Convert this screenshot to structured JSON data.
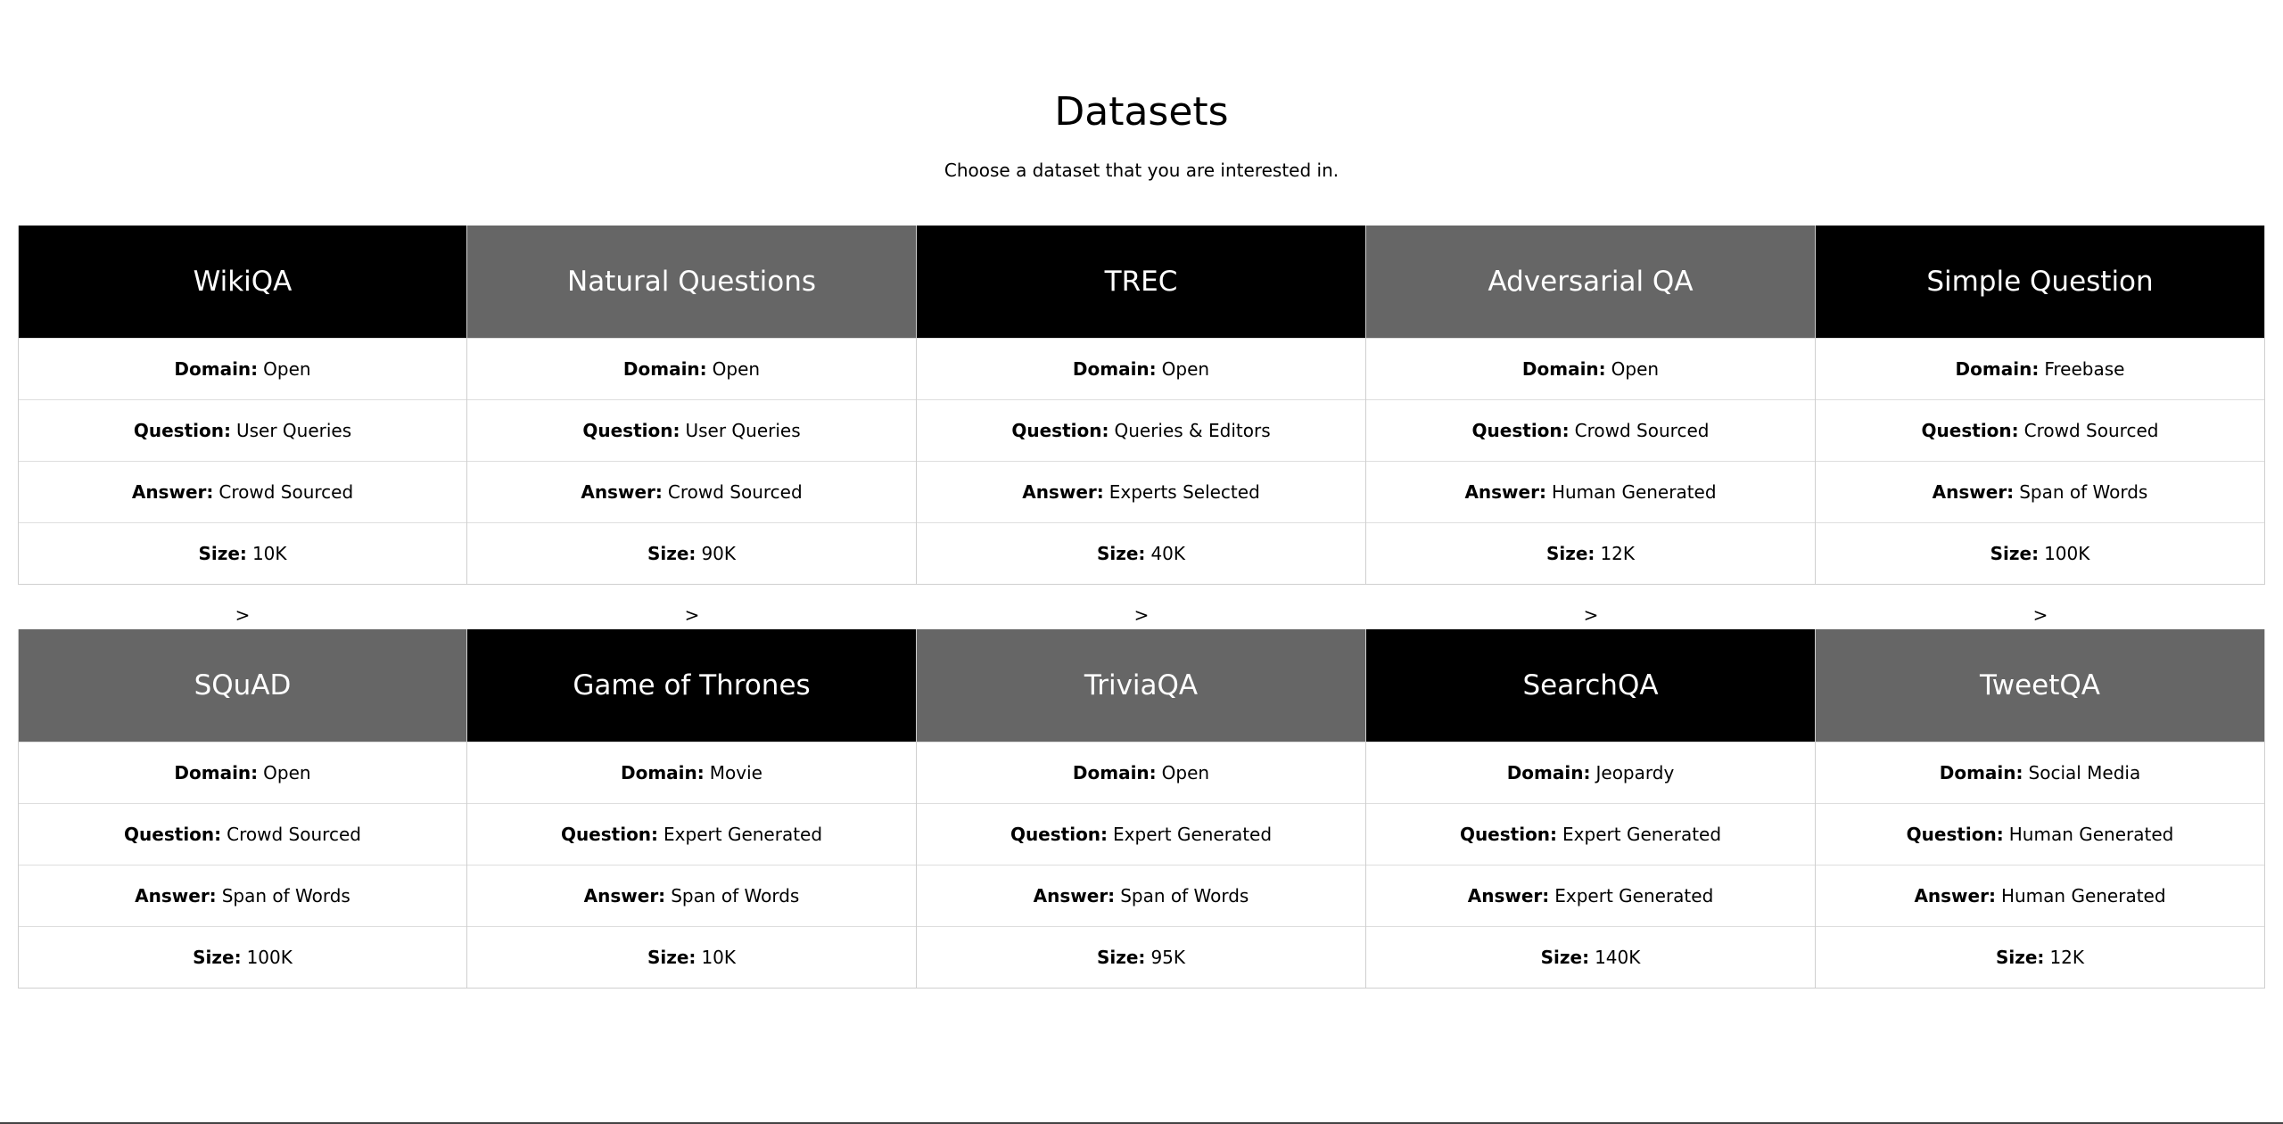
{
  "header": {
    "title": "Datasets",
    "subtitle": "Choose a dataset that you are interested in."
  },
  "labels": {
    "domain": "Domain:",
    "question": "Question:",
    "answer": "Answer:",
    "size": "Size:",
    "arrow": ">"
  },
  "colors": {
    "dark_header": "#000000",
    "gray_header": "#666666"
  },
  "datasets": [
    {
      "name": "WikiQA",
      "header_color": "dark",
      "domain": "Open",
      "question": "User Queries",
      "answer": "Crowd Sourced",
      "size": "10K"
    },
    {
      "name": "Natural Questions",
      "header_color": "gray",
      "domain": "Open",
      "question": "User Queries",
      "answer": "Crowd Sourced",
      "size": "90K"
    },
    {
      "name": "TREC",
      "header_color": "dark",
      "domain": "Open",
      "question": "Queries & Editors",
      "answer": "Experts Selected",
      "size": "40K"
    },
    {
      "name": "Adversarial QA",
      "header_color": "gray",
      "domain": "Open",
      "question": "Crowd Sourced",
      "answer": "Human Generated",
      "size": "12K"
    },
    {
      "name": "Simple Question",
      "header_color": "dark",
      "domain": "Freebase",
      "question": "Crowd Sourced",
      "answer": "Span of Words",
      "size": "100K"
    },
    {
      "name": "SQuAD",
      "header_color": "gray",
      "domain": "Open",
      "question": "Crowd Sourced",
      "answer": "Span of Words",
      "size": "100K"
    },
    {
      "name": "Game of Thrones",
      "header_color": "dark",
      "domain": "Movie",
      "question": "Expert Generated",
      "answer": "Span of Words",
      "size": "10K"
    },
    {
      "name": "TriviaQA",
      "header_color": "gray",
      "domain": "Open",
      "question": "Expert Generated",
      "answer": "Span of Words",
      "size": "95K"
    },
    {
      "name": "SearchQA",
      "header_color": "dark",
      "domain": "Jeopardy",
      "question": "Expert Generated",
      "answer": "Expert Generated",
      "size": "140K"
    },
    {
      "name": "TweetQA",
      "header_color": "gray",
      "domain": "Social Media",
      "question": "Human Generated",
      "answer": "Human Generated",
      "size": "12K"
    }
  ]
}
